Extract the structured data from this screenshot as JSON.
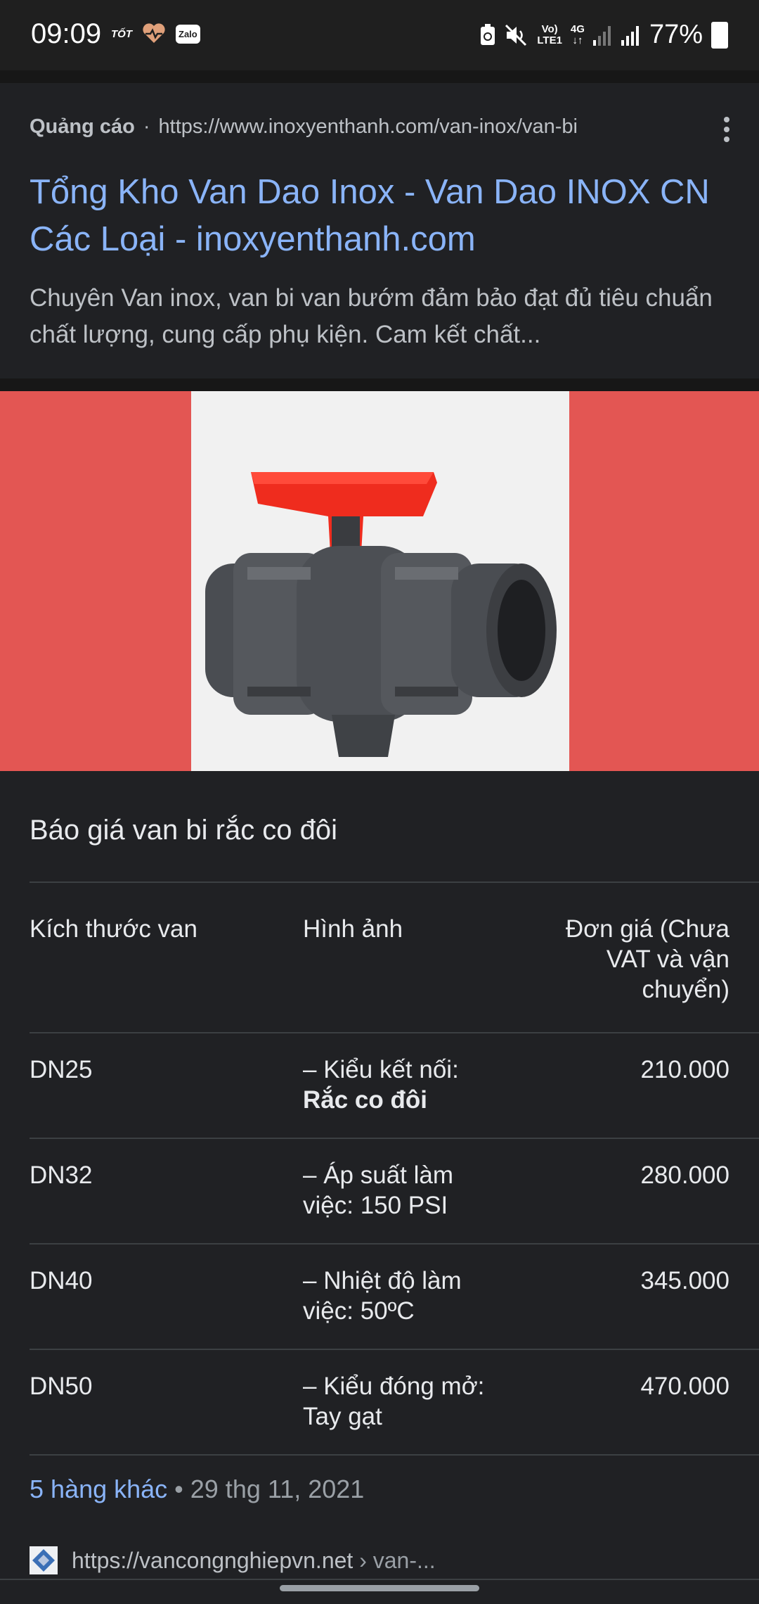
{
  "status_bar": {
    "time": "09:09",
    "left_badge": "TỐT",
    "zalo_label": "Zalo",
    "volte_line1": "Vo)",
    "volte_line2": "LTE1",
    "network": "4G",
    "battery": "77%"
  },
  "ad": {
    "label": "Quảng cáo",
    "separator": "·",
    "url": "https://www.inoxyenthanh.com/van-inox/van-bi",
    "title": "Tổng Kho Van Dao Inox - Van Dao INOX CN Các Loại - inoxyenthanh.com",
    "description": "Chuyên Van inox, van bi van bướm đảm bảo đạt đủ tiêu chuẩn chất lượng, cung cấp phụ kiện. Cam kết chất..."
  },
  "colors": {
    "background": "#202124",
    "link": "#8ab4f8",
    "hero_bg": "#e35653",
    "valve_handle": "#ef2c1e"
  },
  "snippet": {
    "title": "Báo giá van bi rắc co đôi",
    "headers": [
      "Kích thước van",
      "Hình ảnh",
      "Đơn giá (Chưa VAT và vận chuyển)"
    ],
    "rows": [
      {
        "size": "DN25",
        "desc_prefix": "– Kiểu kết nối: ",
        "desc_bold": "Rắc co đôi",
        "price": "210.000"
      },
      {
        "size": "DN32",
        "desc_prefix": "– Áp suất làm việc: 150 PSI",
        "desc_bold": "",
        "price": "280.000"
      },
      {
        "size": "DN40",
        "desc_prefix": "– Nhiệt độ làm việc: 50ºC",
        "desc_bold": "",
        "price": "345.000"
      },
      {
        "size": "DN50",
        "desc_prefix": "– Kiểu đóng mở: Tay gạt",
        "desc_bold": "",
        "price": "470.000"
      }
    ],
    "more_link": "5 hàng khác",
    "more_sep": "•",
    "date": "29 thg 11, 2021"
  },
  "next_result": {
    "url": "https://vancongnghiepvn.net",
    "path": "› van-..."
  }
}
